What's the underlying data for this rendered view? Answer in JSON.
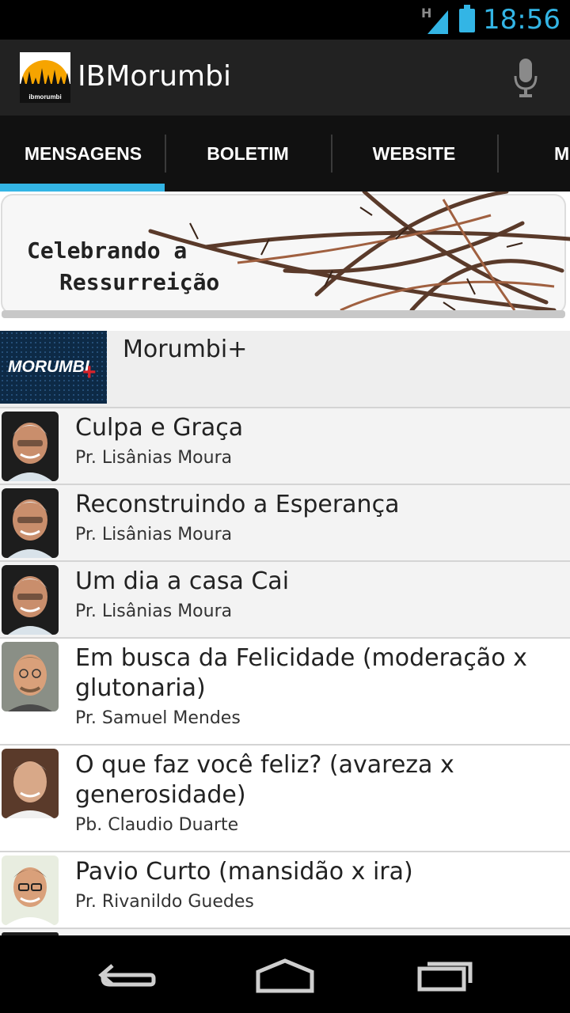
{
  "status": {
    "network": "H",
    "time": "18:56"
  },
  "app": {
    "title": "IBMorumbi"
  },
  "tabs": [
    "MENSAGENS",
    "BOLETIM",
    "WEBSITE",
    "M"
  ],
  "banner": {
    "line1": "Celebrando a",
    "line2": "Ressurreição"
  },
  "featured": {
    "title": "Morumbi+",
    "logo_text": "MORUMBI"
  },
  "messages": [
    {
      "title": "Culpa e Graça",
      "speaker": "Pr. Lisânias Moura"
    },
    {
      "title": "Reconstruindo a Esperança",
      "speaker": "Pr. Lisânias Moura"
    },
    {
      "title": "Um dia a casa Cai",
      "speaker": "Pr. Lisânias Moura"
    },
    {
      "title": "Em busca da Felicidade (moderação x glutonaria)",
      "speaker": "Pr. Samuel Mendes"
    },
    {
      "title": "O que faz você feliz? (avareza x generosidade)",
      "speaker": "Pb. Claudio Duarte"
    },
    {
      "title": "Pavio Curto (mansidão x ira)",
      "speaker": "Pr. Rivanildo Guedes"
    }
  ],
  "colors": {
    "accent": "#33b5e5",
    "actionbar": "#222222",
    "tabbar": "#111111"
  }
}
